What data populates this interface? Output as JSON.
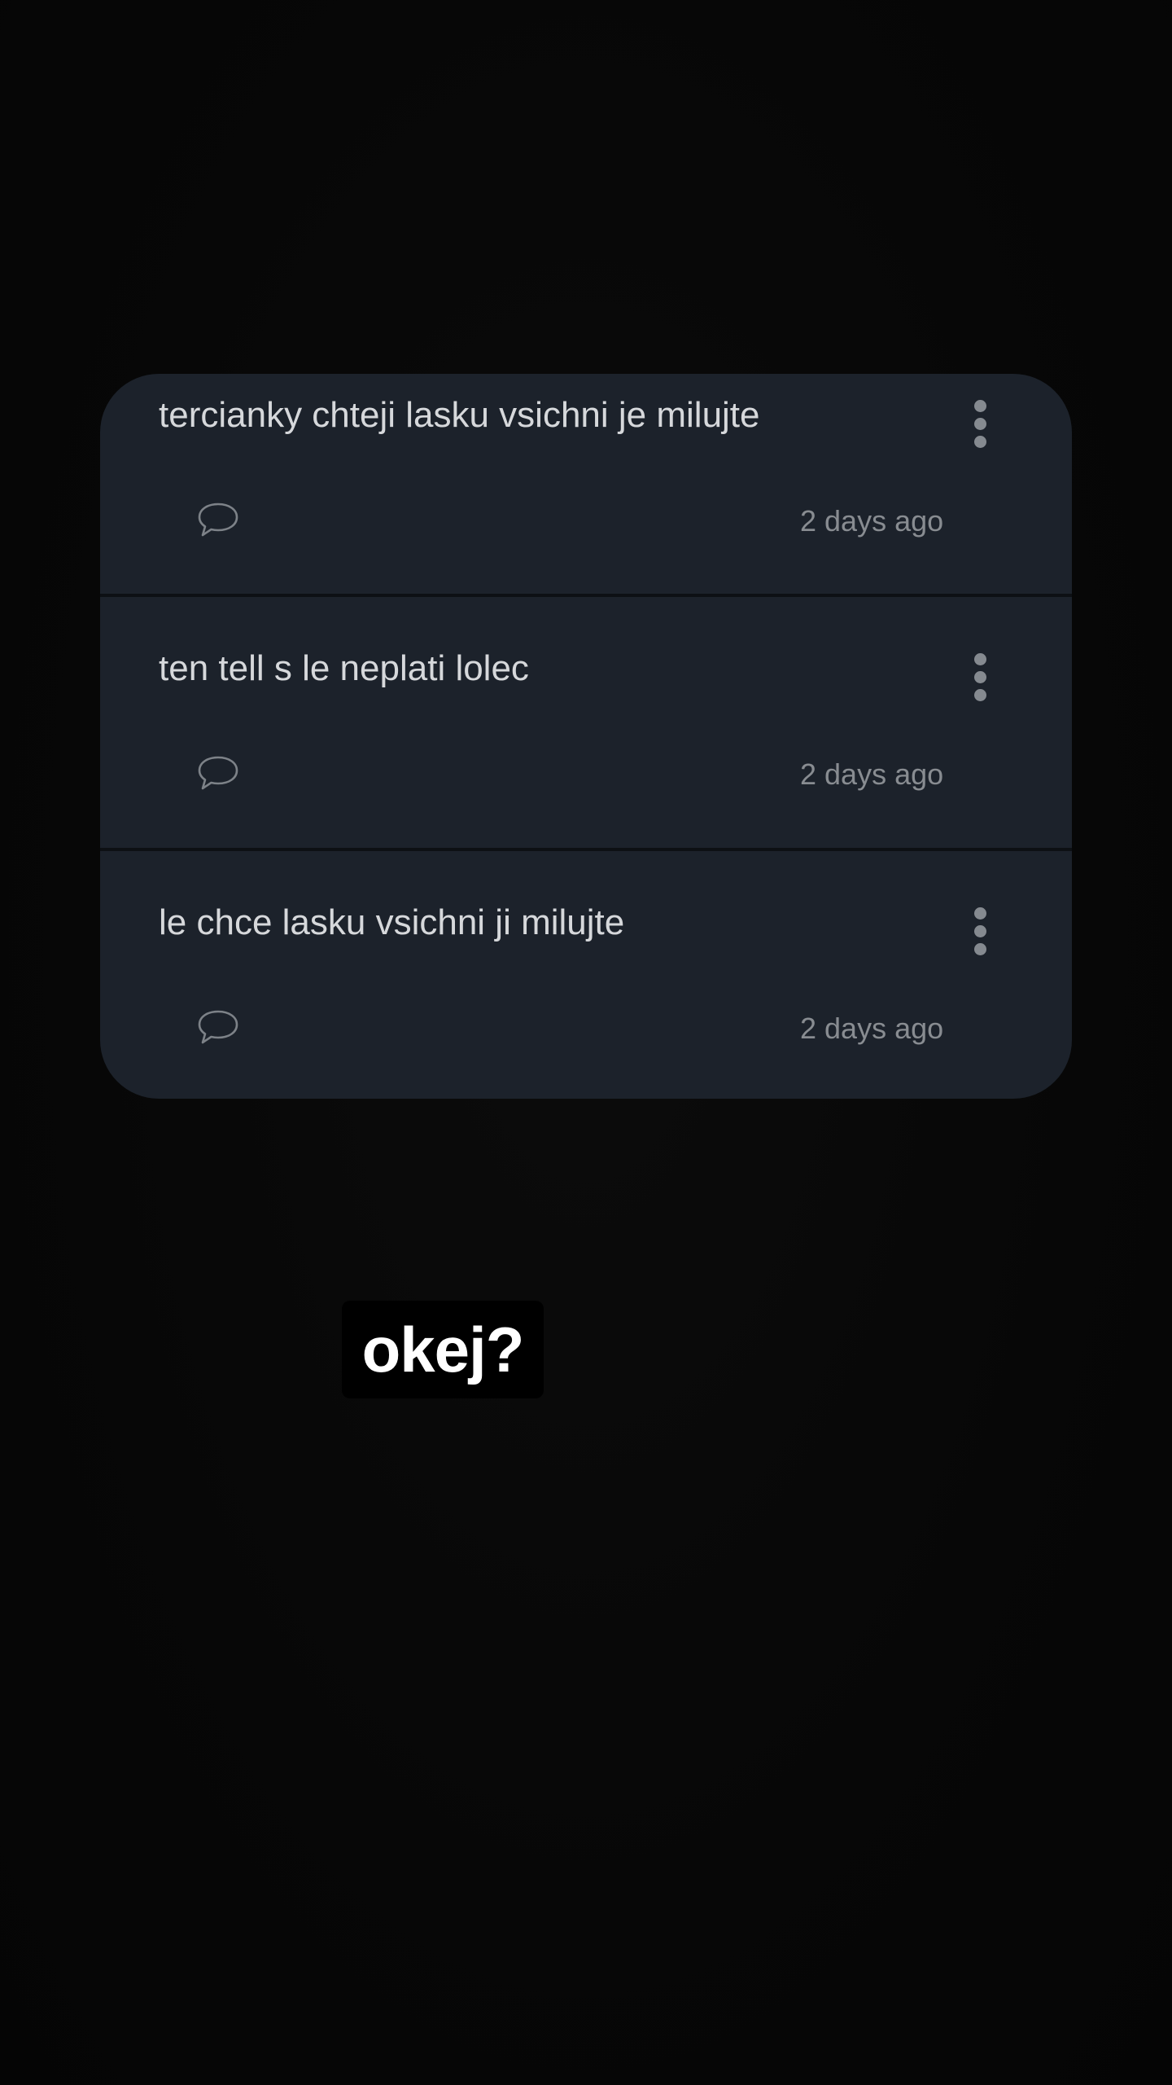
{
  "posts": [
    {
      "text": "tercianky chteji lasku vsichni je milujte",
      "time": "2 days ago"
    },
    {
      "text": "ten tell s le neplati lolec",
      "time": "2 days ago"
    },
    {
      "text": "le chce lasku vsichni ji milujte",
      "time": "2 days ago"
    }
  ],
  "caption": {
    "text": "okej?"
  },
  "icons": {
    "comment": "speech-bubble-icon",
    "menu": "more-vertical-icon"
  },
  "colors": {
    "background": "#070707",
    "card": "#1c222b",
    "post_text": "#d6d8db",
    "time_text": "#888c91",
    "caption_bg": "#000000",
    "caption_text": "#ffffff"
  }
}
